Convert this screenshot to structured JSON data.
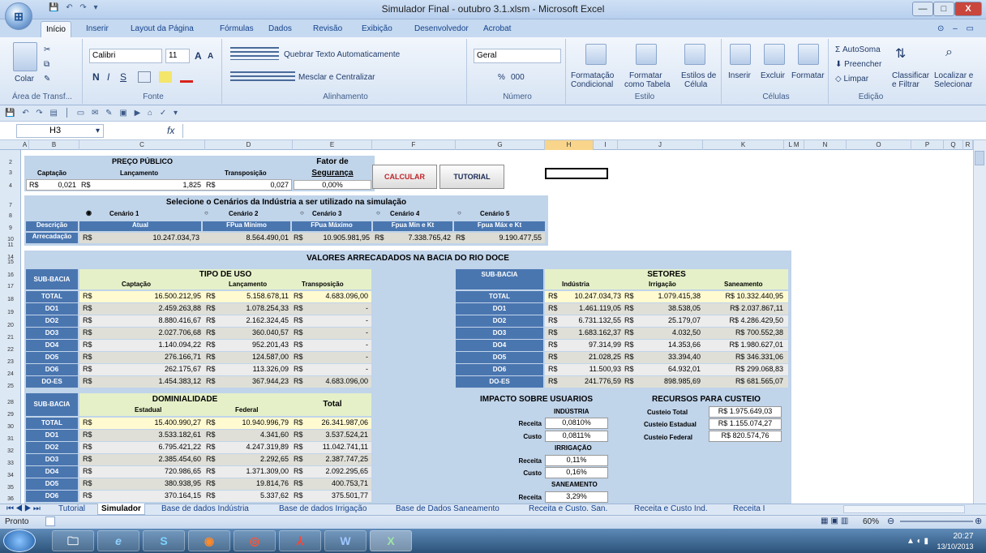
{
  "window": {
    "title": "Simulador Final - outubro 3.1.xlsm - Microsoft Excel",
    "office_button": "⊞",
    "min": "—",
    "max": "□",
    "close": "X"
  },
  "quick_access": "💾 ↶ ↷ ▾",
  "ribbon": {
    "tabs": [
      "Início",
      "Inserir",
      "Layout da Página",
      "Fórmulas",
      "Dados",
      "Revisão",
      "Exibição",
      "Desenvolvedor",
      "Acrobat"
    ],
    "help": "⊙ – ▭ X",
    "clipboard": {
      "paste": "Colar",
      "label": "Área de Transf... "
    },
    "font": {
      "family": "Calibri",
      "size": "11",
      "grow": "A",
      "shrink": "A",
      "bold": "N",
      "italic": "I",
      "underline": "S",
      "label": "Fonte"
    },
    "alignment": {
      "wrap": "Quebrar Texto Automaticamente",
      "merge": "Mesclar e Centralizar",
      "label": "Alinhamento"
    },
    "number": {
      "format": "Geral",
      "percent": "%",
      "thousands": "000",
      "label": "Número"
    },
    "style": {
      "cond": "Formatação",
      "cond2": "Condicional",
      "table": "Formatar",
      "table2": "como Tabela",
      "cell": "Estilos de",
      "cell2": "Célula",
      "label": "Estilo"
    },
    "cells": {
      "insert": "Inserir",
      "delete": "Excluir",
      "format": "Formatar",
      "label": "Células"
    },
    "editing": {
      "autosum": "AutoSoma",
      "fill": "Preencher",
      "clear": "Limpar",
      "sort": "Classificar",
      "sort2": "e Filtrar",
      "find": "Localizar e",
      "find2": "Selecionar",
      "label": "Edição"
    }
  },
  "qat2": "💾 ↶ ↷ ▤ │ ▭ ✉ ✎ ▣ ▶ ⌂ ✓ ▾",
  "formula_bar": {
    "cell": "H3",
    "fx": "fx",
    "content": ""
  },
  "columns": [
    "A",
    "B",
    "C",
    "D",
    "E",
    "F",
    "G",
    "H",
    "I",
    "J",
    "K",
    "L M",
    "N",
    "O",
    "P",
    "Q",
    "R"
  ],
  "rows": [
    "2",
    "3",
    "4",
    "7",
    "8",
    "9",
    "10",
    "11",
    "14",
    "15",
    "16",
    "17",
    "18",
    "19",
    "20",
    "21",
    "22",
    "23",
    "24",
    "25",
    "28",
    "29",
    "30",
    "31",
    "32",
    "33",
    "34",
    "35",
    "36"
  ],
  "preco": {
    "title": "PREÇO PÚBLICO",
    "captacao": "Captação",
    "lancamento": "Lançamento",
    "transposicao": "Transposição",
    "cap_cur": "R$",
    "cap_val": "0,021",
    "lan_cur": "R$",
    "lan_val": "1,825",
    "tra_cur": "R$",
    "tra_val": "0,027",
    "fator_title": "Fator de",
    "fator_title2": "Segurança",
    "fator_val": "0,00%"
  },
  "buttons": {
    "calcular": "CALCULAR",
    "tutorial": "TUTORIAL"
  },
  "cenarios": {
    "title": "Selecione o Cenários da Indústria a ser utilizado na simulação",
    "names": [
      "Cenário 1",
      "Cenário 2",
      "Cenário 3",
      "Cenário 4",
      "Cenário 5"
    ],
    "descricao_label": "Descrição",
    "descricoes": [
      "Atual",
      "FPua Mínimo",
      "FPua Máximo",
      "Fpua Min e Kt",
      "Fpua Máx e Kt"
    ],
    "arrecadacao_label": "Arrecadação",
    "currency": "R$",
    "values": [
      "10.247.034,73",
      "8.564.490,01",
      "10.905.981,95",
      "7.338.765,42",
      "9.190.477,55"
    ]
  },
  "valores_title": "VALORES ARRECADADOS NA BACIA DO RIO DOCE",
  "uso": {
    "sub_bacia": "SUB-BACIA",
    "title": "TIPO DE USO",
    "headers": [
      "Captação",
      "Lançamento",
      "Transposição"
    ],
    "rows": [
      {
        "name": "TOTAL",
        "cap": "16.500.212,95",
        "lan": "5.158.678,11",
        "tra": "4.683.096,00"
      },
      {
        "name": "DO1",
        "cap": "2.459.263,88",
        "lan": "1.078.254,33",
        "tra": "-"
      },
      {
        "name": "DO2",
        "cap": "8.880.416,67",
        "lan": "2.162.324,45",
        "tra": "-"
      },
      {
        "name": "DO3",
        "cap": "2.027.706,68",
        "lan": "360.040,57",
        "tra": "-"
      },
      {
        "name": "DO4",
        "cap": "1.140.094,22",
        "lan": "952.201,43",
        "tra": "-"
      },
      {
        "name": "DO5",
        "cap": "276.166,71",
        "lan": "124.587,00",
        "tra": "-"
      },
      {
        "name": "DO6",
        "cap": "262.175,67",
        "lan": "113.326,09",
        "tra": "-"
      },
      {
        "name": "DO-ES",
        "cap": "1.454.383,12",
        "lan": "367.944,23",
        "tra": "4.683.096,00"
      }
    ]
  },
  "setores": {
    "sub_bacia": "SUB-BACIA",
    "title": "SETORES",
    "headers": [
      "Indústria",
      "Irrigação",
      "Saneamento"
    ],
    "rows": [
      {
        "name": "TOTAL",
        "ind": "10.247.034,73",
        "irr": "1.079.415,38",
        "san": "R$ 10.332.440,95"
      },
      {
        "name": "DO1",
        "ind": "1.461.119,05",
        "irr": "38.538,05",
        "san": "R$ 2.037.867,11"
      },
      {
        "name": "DO2",
        "ind": "6.731.132,55",
        "irr": "25.179,07",
        "san": "R$ 4.286.429,50"
      },
      {
        "name": "DO3",
        "ind": "1.683.162,37",
        "irr": "4.032,50",
        "san": "R$ 700.552,38"
      },
      {
        "name": "DO4",
        "ind": "97.314,99",
        "irr": "14.353,66",
        "san": "R$ 1.980.627,01"
      },
      {
        "name": "DO5",
        "ind": "21.028,25",
        "irr": "33.394,40",
        "san": "R$ 346.331,06"
      },
      {
        "name": "DO6",
        "ind": "11.500,93",
        "irr": "64.932,01",
        "san": "R$ 299.068,83"
      },
      {
        "name": "DO-ES",
        "ind": "241.776,59",
        "irr": "898.985,69",
        "san": "R$ 681.565,07"
      }
    ]
  },
  "dominialidade": {
    "sub_bacia": "SUB-BACIA",
    "title": "DOMINIALIDADE",
    "total": "Total",
    "headers": [
      "Estadual",
      "Federal"
    ],
    "rows": [
      {
        "name": "TOTAL",
        "est": "15.400.990,27",
        "fed": "10.940.996,79",
        "tot": "26.341.987,06"
      },
      {
        "name": "DO1",
        "est": "3.533.182,61",
        "fed": "4.341,60",
        "tot": "3.537.524,21"
      },
      {
        "name": "DO2",
        "est": "6.795.421,22",
        "fed": "4.247.319,89",
        "tot": "11.042.741,11"
      },
      {
        "name": "DO3",
        "est": "2.385.454,60",
        "fed": "2.292,65",
        "tot": "2.387.747,25"
      },
      {
        "name": "DO4",
        "est": "720.986,65",
        "fed": "1.371.309,00",
        "tot": "2.092.295,65"
      },
      {
        "name": "DO5",
        "est": "380.938,95",
        "fed": "19.814,76",
        "tot": "400.753,71"
      },
      {
        "name": "DO6",
        "est": "370.164,15",
        "fed": "5.337,62",
        "tot": "375.501,77"
      }
    ]
  },
  "impacto": {
    "title": "IMPACTO SOBRE USUÁRIOS",
    "industria": "INDÚSTRIA",
    "irrigacao": "IRRIGAÇÃO",
    "saneamento": "SANEAMENTO",
    "receita": "Receita",
    "custo": "Custo",
    "ind_receita": "0,0810%",
    "ind_custo": "0,0811%",
    "irr_receita": "0,11%",
    "irr_custo": "0,16%",
    "san_receita": "3,29%"
  },
  "recursos": {
    "title": "RECURSOS PARA CUSTEIO",
    "labels": [
      "Custeio Total",
      "Custeio Estadual",
      "Custeio Federal"
    ],
    "values": [
      "R$ 1.975.649,03",
      "R$ 1.155.074,27",
      "R$ 820.574,76"
    ]
  },
  "sheet_tabs": [
    "Tutorial",
    "Simulador",
    "Base de dados Indústria",
    "Base de dados Irrigação",
    "Base de Dados Saneamento",
    "Receita e Custo. San.",
    "Receita e Custo Ind.",
    "Receita I"
  ],
  "status": {
    "ready": "Pronto",
    "zoom": "60%"
  },
  "taskbar": {
    "time": "20:27",
    "date": "13/10/2013"
  },
  "currency": "R$"
}
